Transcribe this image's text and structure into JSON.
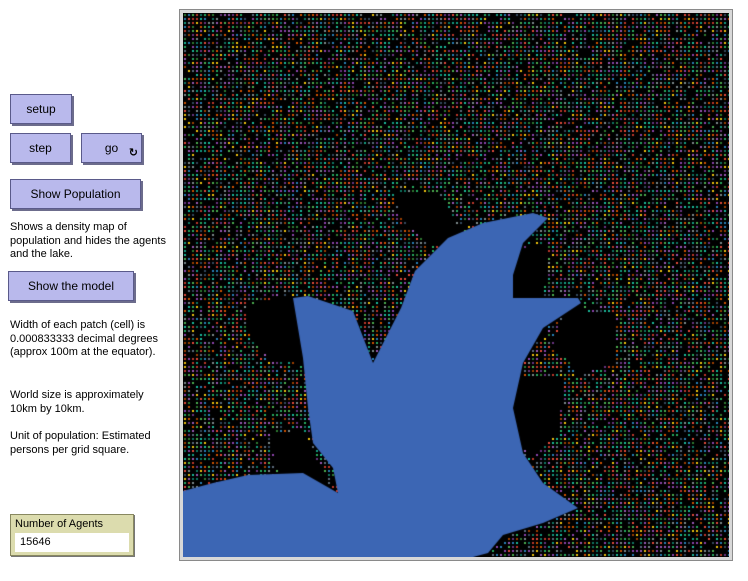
{
  "buttons": {
    "setup": "setup",
    "step": "step",
    "go": "go",
    "go_forever_icon": "loop-arrows-icon",
    "show_population": "Show Population",
    "show_model": "Show the model"
  },
  "notes": {
    "show_population_desc": "Shows a density map of population and hides the agents and the lake.",
    "patch_width": "Width of each patch (cell) is 0.000833333 decimal degrees (approx 100m at the equator).",
    "world_size": "World size is approximately 10km by 10km.",
    "population_unit": "Unit of population: Estimated persons per grid square."
  },
  "monitor": {
    "label": "Number of Agents",
    "value": "15646"
  },
  "colors": {
    "button_bg": "#b9b9ec",
    "monitor_bg": "#dcdcae",
    "lake": "#3c66b4",
    "background": "#000000"
  }
}
